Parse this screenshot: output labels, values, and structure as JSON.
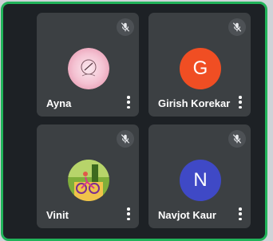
{
  "participants": [
    {
      "name": "Ayna",
      "avatar": "ayna-profile-image",
      "muted": true
    },
    {
      "name": "Girish Korekar",
      "avatar_letter": "G",
      "avatar_color": "#f04e23",
      "muted": true
    },
    {
      "name": "Vinit",
      "avatar": "vinit-profile-image",
      "muted": true
    },
    {
      "name": "Navjot Kaur",
      "avatar_letter": "N",
      "avatar_color": "#3f49c6",
      "muted": true
    }
  ],
  "icons": {
    "mute": "mic-off-icon",
    "options": "more-vert-icon"
  },
  "colors": {
    "frame_border": "#21b35a",
    "tile_bg": "#3c4043",
    "background": "#1d2125"
  }
}
